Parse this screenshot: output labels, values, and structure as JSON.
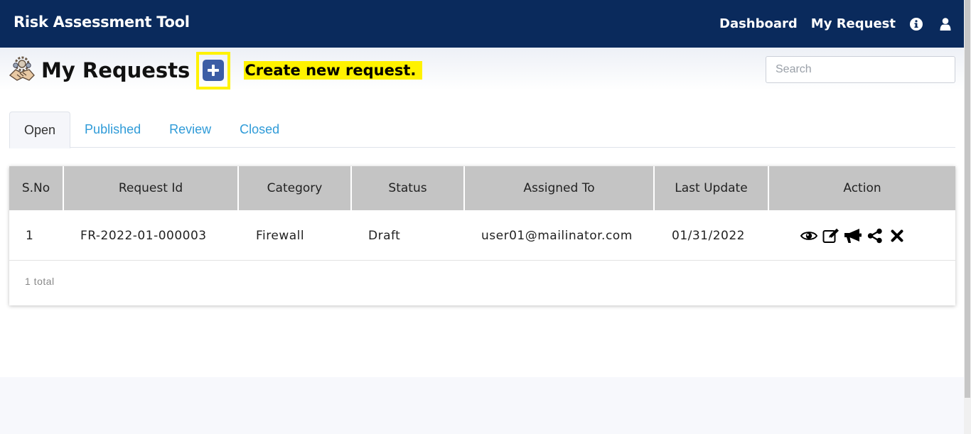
{
  "navbar": {
    "brand": "Risk Assessment Tool",
    "links": [
      "Dashboard",
      "My Request"
    ],
    "icons": [
      "info-icon",
      "user-icon"
    ],
    "background": "#0a2a5c"
  },
  "page": {
    "title": "My Requests",
    "title_icon": "handshake-gears-icon",
    "add_icon": "plus-square-icon",
    "highlight_text": "Create new request.",
    "search_placeholder": "Search"
  },
  "tabs": [
    {
      "label": "Open",
      "active": true
    },
    {
      "label": "Published",
      "active": false
    },
    {
      "label": "Review",
      "active": false
    },
    {
      "label": "Closed",
      "active": false
    }
  ],
  "table": {
    "columns": [
      "S.No",
      "Request Id",
      "Category",
      "Status",
      "Assigned To",
      "Last Update",
      "Action"
    ],
    "rows": [
      {
        "sno": "1",
        "request_id": "FR-2022-01-000003",
        "category": "Firewall",
        "status": "Draft",
        "assigned_to": "user01@mailinator.com",
        "last_update": "01/31/2022",
        "actions": [
          "eye-icon",
          "edit-icon",
          "megaphone-icon",
          "share-icon",
          "close-icon"
        ]
      }
    ],
    "total_text": "1 total"
  },
  "colors": {
    "accent": "#2f9bd8",
    "highlight": "#fff200",
    "add_button": "#3c5da5",
    "header_row": "#c4c4c4"
  }
}
